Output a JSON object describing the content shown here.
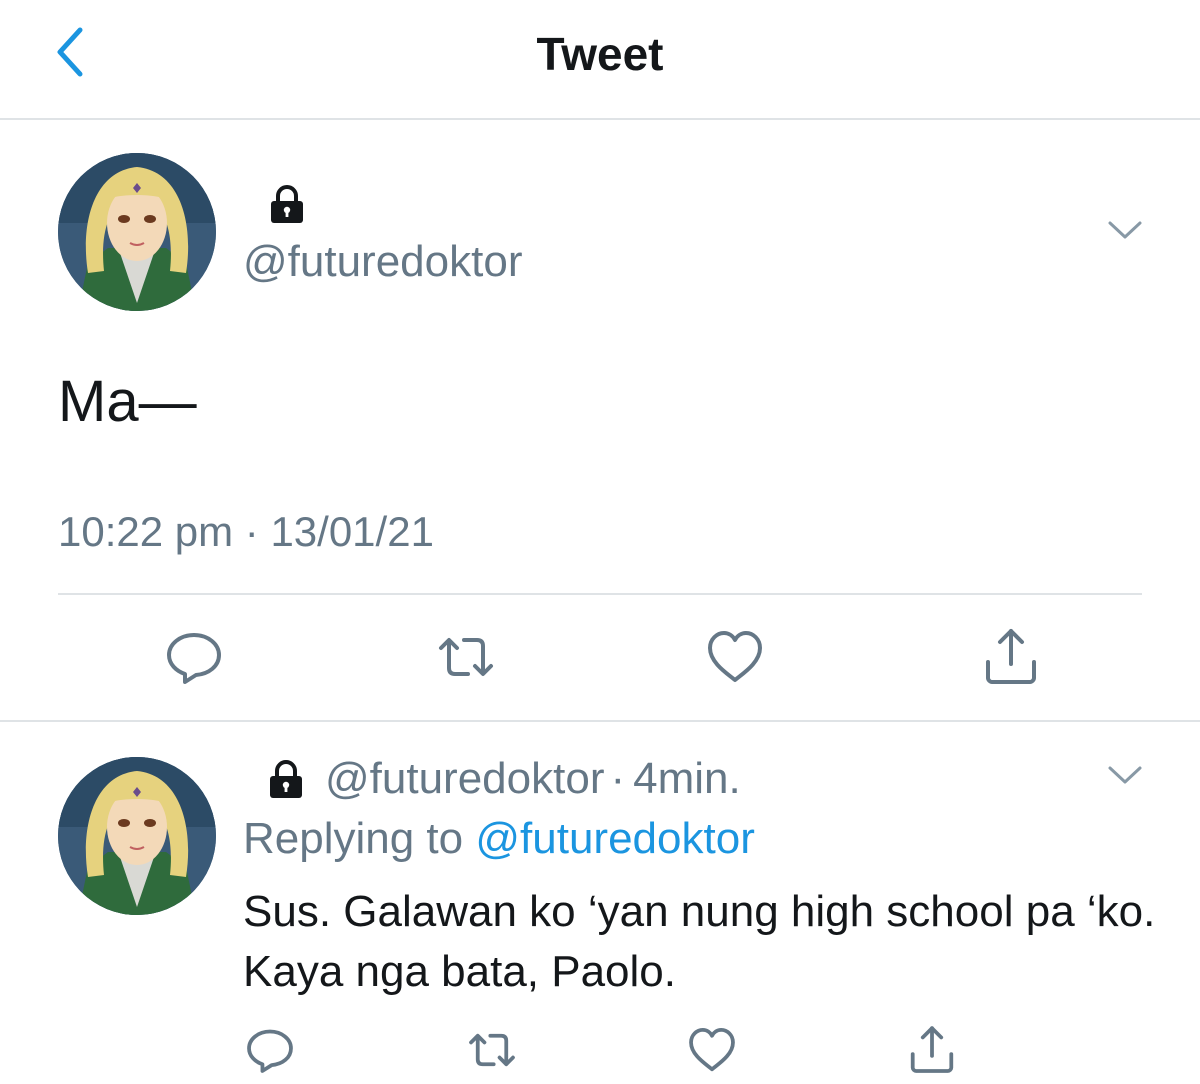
{
  "header": {
    "title": "Tweet"
  },
  "tweet": {
    "handle": "@futuredoktor",
    "text": "Ma—",
    "timestamp": "10:22 pm · 13/01/21"
  },
  "reply": {
    "handle": "@futuredoktor",
    "separator": "·",
    "time": "4min.",
    "replying_prefix": "Replying to",
    "replying_to": "@futuredoktor",
    "text": "Sus. Galawan ko ‘yan nung high school pa ‘ko. Kaya nga bata, Paolo."
  },
  "colors": {
    "accent": "#1b95e0",
    "muted": "#657786",
    "text": "#14171a",
    "icon": "#657786",
    "back": "#1b95e0"
  },
  "icons": [
    "chevron-left-icon",
    "lock-icon",
    "chevron-down-icon",
    "reply-icon",
    "retweet-icon",
    "like-icon",
    "share-icon"
  ]
}
